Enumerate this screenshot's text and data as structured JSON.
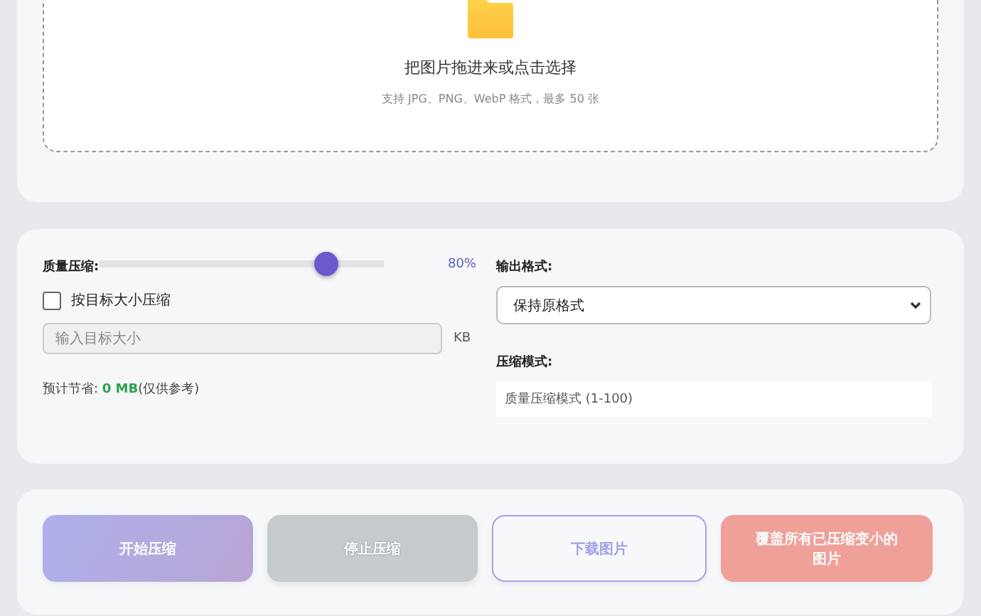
{
  "upload": {
    "title": "把图片拖进来或点击选择",
    "hint": "支持 JPG、PNG、WebP 格式，最多 50 张"
  },
  "settings": {
    "quality_label": "质量压缩:",
    "quality": {
      "level": 0.8,
      "reading": "80%"
    },
    "target_checkbox": {
      "label": "按目标大小压缩",
      "checked": false
    },
    "target_input": {
      "placeholder": "输入目标大小",
      "unit": "KB"
    },
    "savings": "预计节省: **0 MB**(仅供参考)",
    "format_label": "输出格式:",
    "format_value": "保持原格式",
    "mode_label": "压缩模式:",
    "mode_value": "质量压缩模式 (1-100)"
  },
  "buttons": [
    {
      "label": "开始压缩",
      "kind": "primary",
      "disabled": true
    },
    {
      "label": "停止压缩",
      "kind": "secondary",
      "disabled": true
    },
    {
      "label": "下载图片",
      "kind": "outline",
      "disabled": true
    },
    {
      "label": "覆盖所有已压缩变小的图片",
      "kind": "danger",
      "disabled": true
    }
  ]
}
